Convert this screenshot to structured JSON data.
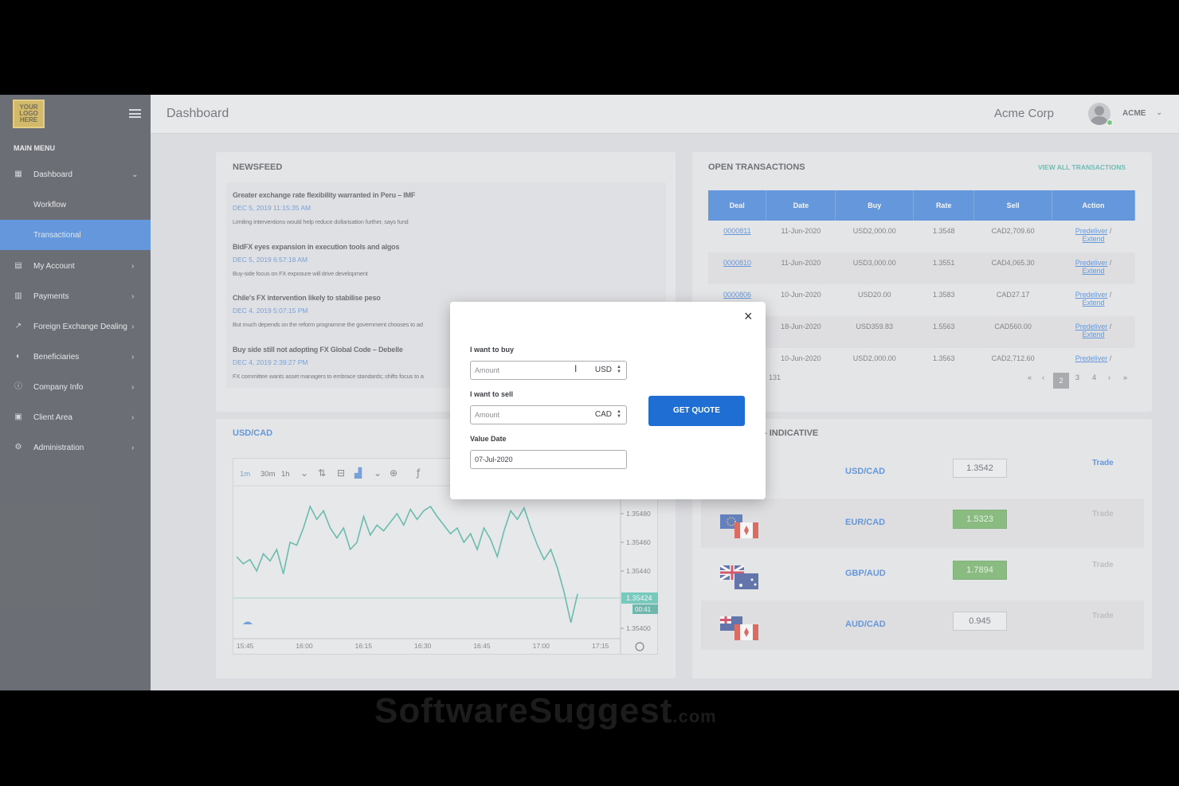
{
  "logo": {
    "text": "YOUR LOGO HERE"
  },
  "header": {
    "title": "Dashboard",
    "company": "Acme Corp",
    "user": "ACME"
  },
  "sidebar": {
    "menu_title": "MAIN MENU",
    "items": [
      {
        "label": "Dashboard",
        "icon": "dashboard-icon"
      },
      {
        "label": "Workflow"
      },
      {
        "label": "Transactional"
      },
      {
        "label": "My Account",
        "icon": "account-icon"
      },
      {
        "label": "Payments",
        "icon": "payments-icon"
      },
      {
        "label": "Foreign Exchange Dealing",
        "icon": "chart-icon"
      },
      {
        "label": "Beneficiaries",
        "icon": "beneficiaries-icon"
      },
      {
        "label": "Company Info",
        "icon": "info-icon"
      },
      {
        "label": "Client Area",
        "icon": "client-icon"
      },
      {
        "label": "Administration",
        "icon": "gear-icon"
      }
    ]
  },
  "newsfeed": {
    "title": "NEWSFEED",
    "items": [
      {
        "headline": "Greater exchange rate flexibility warranted in Peru – IMF",
        "date": "DEC 5, 2019 11:15:35 AM",
        "text": "Limiting interventions would help reduce dollarisation further, says fund"
      },
      {
        "headline": "BidFX eyes expansion in execution tools and algos",
        "date": "DEC 5, 2019 6:57:18 AM",
        "text": "Buy-side focus on FX exposure will drive development"
      },
      {
        "headline": "Chile's FX intervention likely to stabilise peso",
        "date": "DEC 4, 2019 5:07:15 PM",
        "text": "But much depends on the reform programme the government chooses to ad"
      },
      {
        "headline": "Buy side still not adopting FX Global Code – Debelle",
        "date": "DEC 4, 2019 2:39:27 PM",
        "text": "FX committee wants asset managers to embrace standards; shifts focus to a"
      }
    ]
  },
  "transactions": {
    "title": "OPEN TRANSACTIONS",
    "view_all": "VIEW ALL TRANSACTIONS",
    "columns": [
      "Deal",
      "Date",
      "Buy",
      "Rate",
      "Sell",
      "Action"
    ],
    "rows": [
      {
        "deal": "0000811",
        "date": "11-Jun-2020",
        "buy": "USD2,000.00",
        "rate": "1.3548",
        "sell": "CAD2,709.60",
        "action1": "Predeliver",
        "action2": "Extend"
      },
      {
        "deal": "0000810",
        "date": "11-Jun-2020",
        "buy": "USD3,000.00",
        "rate": "1.3551",
        "sell": "CAD4,065.30",
        "action1": "Predeliver",
        "action2": "Extend"
      },
      {
        "deal": "0000806",
        "date": "10-Jun-2020",
        "buy": "USD20.00",
        "rate": "1.3583",
        "sell": "CAD27.17",
        "action1": "Predeliver",
        "action2": "Extend"
      },
      {
        "deal": "",
        "date": "18-Jun-2020",
        "buy": "USD359.83",
        "rate": "1.5563",
        "sell": "CAD560.00",
        "action1": "Predeliver",
        "action2": "Extend"
      },
      {
        "deal": "",
        "date": "10-Jun-2020",
        "buy": "USD2,000.00",
        "rate": "1.3563",
        "sell": "CAD2,712.60",
        "action1": "Predeliver",
        "action2": ""
      }
    ],
    "total": "131",
    "pages": [
      "«",
      "‹",
      "2",
      "3",
      "4",
      "›",
      "»"
    ]
  },
  "rates": {
    "title": "- INDICATIVE",
    "rows": [
      {
        "pair": "USD/CAD",
        "rate": "1.3542",
        "trade": "Trade"
      },
      {
        "pair": "EUR/CAD",
        "rate": "1.5323",
        "trade": "Trade"
      },
      {
        "pair": "GBP/AUD",
        "rate": "1.7894",
        "trade": "Trade"
      },
      {
        "pair": "AUD/CAD",
        "rate": "0.945",
        "trade": "Trade"
      }
    ]
  },
  "chart": {
    "title": "USD/CAD",
    "toolbar": [
      "1m",
      "30m",
      "1h"
    ],
    "price_tag": "1.35424",
    "time_tag": "00:41"
  },
  "chart_data": {
    "type": "line",
    "x": [
      "15:45",
      "16:00",
      "16:15",
      "16:30",
      "16:45",
      "17:00",
      "17:15"
    ],
    "y_ticks": [
      "1.35480",
      "1.35460",
      "1.35440",
      "1.35400"
    ],
    "ylim": [
      1.35395,
      1.35495
    ],
    "series": [
      {
        "values": [
          1.3545,
          1.35445,
          1.35448,
          1.3544,
          1.35452,
          1.35447,
          1.35455,
          1.35438,
          1.3546,
          1.35458,
          1.3547,
          1.35485,
          1.35476,
          1.35482,
          1.3547,
          1.35463,
          1.3547,
          1.35455,
          1.3546,
          1.35478,
          1.35465,
          1.35472,
          1.35468,
          1.35474,
          1.3548,
          1.35472,
          1.35483,
          1.35476,
          1.35482,
          1.35485,
          1.35478,
          1.35472,
          1.35466,
          1.3547,
          1.3546,
          1.35466,
          1.35455,
          1.3547,
          1.35462,
          1.3545,
          1.35468,
          1.35482,
          1.35476,
          1.35484,
          1.3547,
          1.35458,
          1.35448,
          1.35455,
          1.35442,
          1.35425,
          1.35404,
          1.35424
        ]
      }
    ]
  },
  "quote_modal": {
    "buy_label": "I want to buy",
    "buy_placeholder": "Amount",
    "buy_currency": "USD",
    "sell_label": "I want to sell",
    "sell_placeholder": "Amount",
    "sell_currency": "CAD",
    "date_label": "Value Date",
    "date_value": "07-Jul-2020",
    "button": "GET QUOTE",
    "close": "×"
  },
  "watermark": {
    "main": "SoftwareSuggest",
    "suffix": ".com"
  }
}
